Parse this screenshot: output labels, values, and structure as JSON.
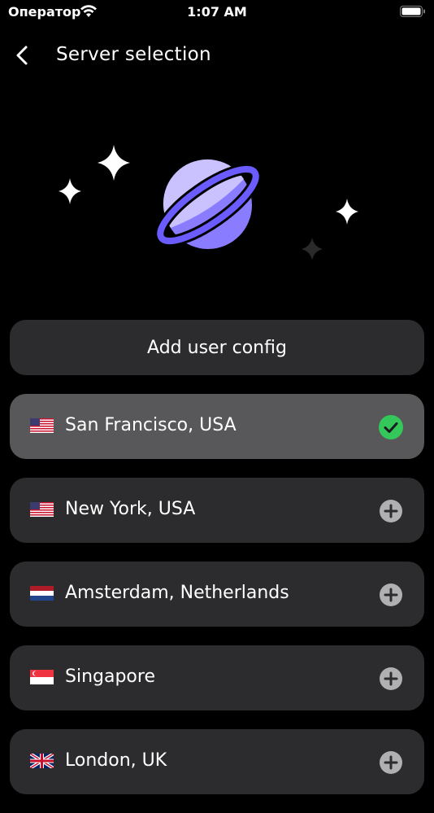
{
  "status_bar": {
    "carrier": "Оператор",
    "time": "1:07 AM"
  },
  "nav": {
    "title": "Server selection"
  },
  "add_config": {
    "label": "Add user config"
  },
  "servers": [
    {
      "name": "San Francisco, USA",
      "flag": "us-flag-icon",
      "selected": true
    },
    {
      "name": "New York, USA",
      "flag": "us-flag-icon",
      "selected": false
    },
    {
      "name": "Amsterdam, Netherlands",
      "flag": "nl-flag-icon",
      "selected": false
    },
    {
      "name": "Singapore",
      "flag": "sg-flag-icon",
      "selected": false
    },
    {
      "name": "London, UK",
      "flag": "uk-flag-icon",
      "selected": false
    }
  ],
  "colors": {
    "background": "#000000",
    "card": "#2c2c2e",
    "card_selected": "#58585a",
    "check": "#34c759",
    "planet": "#6a5cff"
  }
}
